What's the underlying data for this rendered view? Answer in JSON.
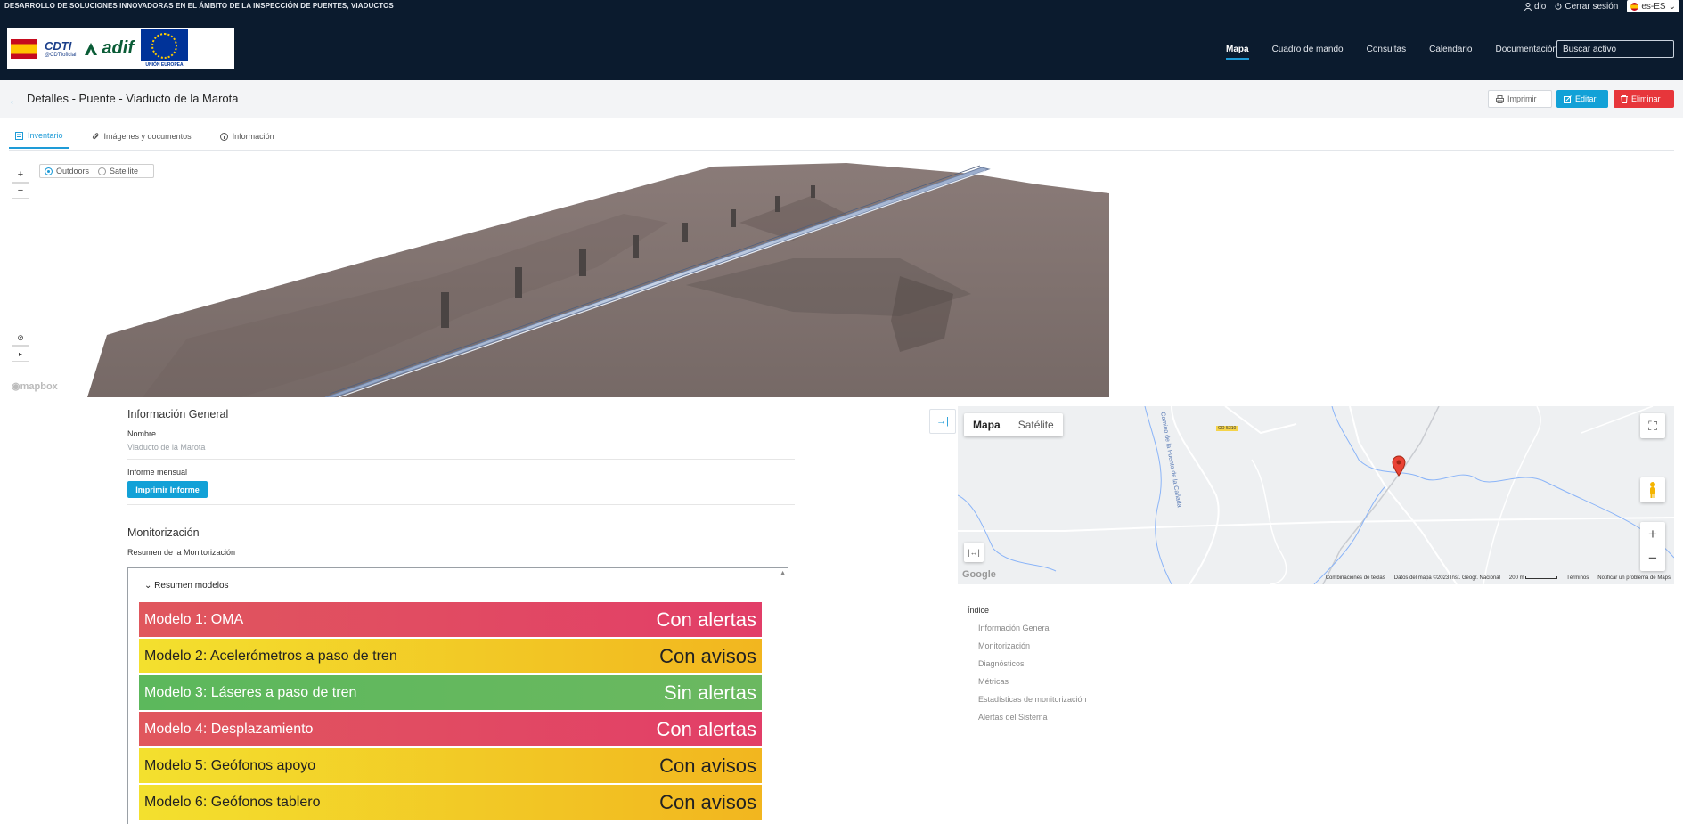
{
  "header": {
    "project_title": "DESARROLLO DE SOLUCIONES INNOVADORAS EN EL ÁMBITO DE LA INSPECCIÓN DE PUENTES, VIADUCTOS",
    "user": "dlo",
    "logout": "Cerrar sesión",
    "language": "es-ES",
    "logos": {
      "cdti": "CDTI",
      "cdti_handle": "@CDTIoficial",
      "adif": "adif",
      "eu": "UNIÓN EUROPEA"
    },
    "nav": [
      "Mapa",
      "Cuadro de mando",
      "Consultas",
      "Calendario",
      "Documentación"
    ],
    "active_nav": "Mapa",
    "search_placeholder": "Buscar activo"
  },
  "title_bar": {
    "title": "Detalles - Puente - Viaducto de la Marota",
    "print_label": "Imprimir",
    "edit_label": "Editar",
    "delete_label": "Eliminar"
  },
  "tabs": [
    {
      "label": "Inventario",
      "icon": "inventory-icon",
      "active": true
    },
    {
      "label": "Imágenes y documentos",
      "icon": "paperclip-icon",
      "active": false
    },
    {
      "label": "Información",
      "icon": "info-icon",
      "active": false
    }
  ],
  "view3d": {
    "zoom_in": "+",
    "zoom_out": "−",
    "styles": [
      {
        "label": "Outdoors",
        "selected": true
      },
      {
        "label": "Satellite",
        "selected": false
      }
    ],
    "attribution": "mapbox"
  },
  "info_general": {
    "heading": "Información General",
    "name_label": "Nombre",
    "name_value": "Viaducto de la Marota",
    "monthly_report_label": "Informe mensual",
    "print_report_button": "Imprimir Informe"
  },
  "monitoring": {
    "heading": "Monitorización",
    "summary_label": "Resumen de la Monitorización",
    "models_title": "Resumen modelos",
    "models": [
      {
        "name": "Modelo 1: OMA",
        "status": "Con alertas",
        "level": "red"
      },
      {
        "name": "Modelo 2: Acelerómetros a paso de tren",
        "status": "Con avisos",
        "level": "yellow"
      },
      {
        "name": "Modelo 3: Láseres a paso de tren",
        "status": "Sin alertas",
        "level": "green"
      },
      {
        "name": "Modelo 4: Desplazamiento",
        "status": "Con alertas",
        "level": "red"
      },
      {
        "name": "Modelo 5: Geófonos apoyo",
        "status": "Con avisos",
        "level": "yellow"
      },
      {
        "name": "Modelo 6: Geófonos tablero",
        "status": "Con avisos",
        "level": "yellow"
      }
    ]
  },
  "google_map": {
    "map_type_map": "Mapa",
    "map_type_satellite": "Satélite",
    "road_label": "CO-5310",
    "road_name": "Camino de la Fuente de la Cañada",
    "footer": {
      "shortcuts": "Combinaciones de teclas",
      "data": "Datos del mapa ©2023 Inst. Geogr. Nacional",
      "scale": "200 m",
      "terms": "Términos",
      "report": "Notificar un problema de Maps"
    },
    "logo": "Google"
  },
  "index": {
    "heading": "Índice",
    "items": [
      "Información General",
      "Monitorización",
      "Diagnósticos",
      "Métricas",
      "Estadísticas de monitorización",
      "Alertas del Sistema"
    ]
  },
  "colors": {
    "navy": "#0b1b2e",
    "accent": "#1e9bd7",
    "danger": "#e7363b",
    "alert_red": "#e2485f",
    "warning_yellow": "#f3d02a",
    "ok_green": "#5fb85d"
  }
}
